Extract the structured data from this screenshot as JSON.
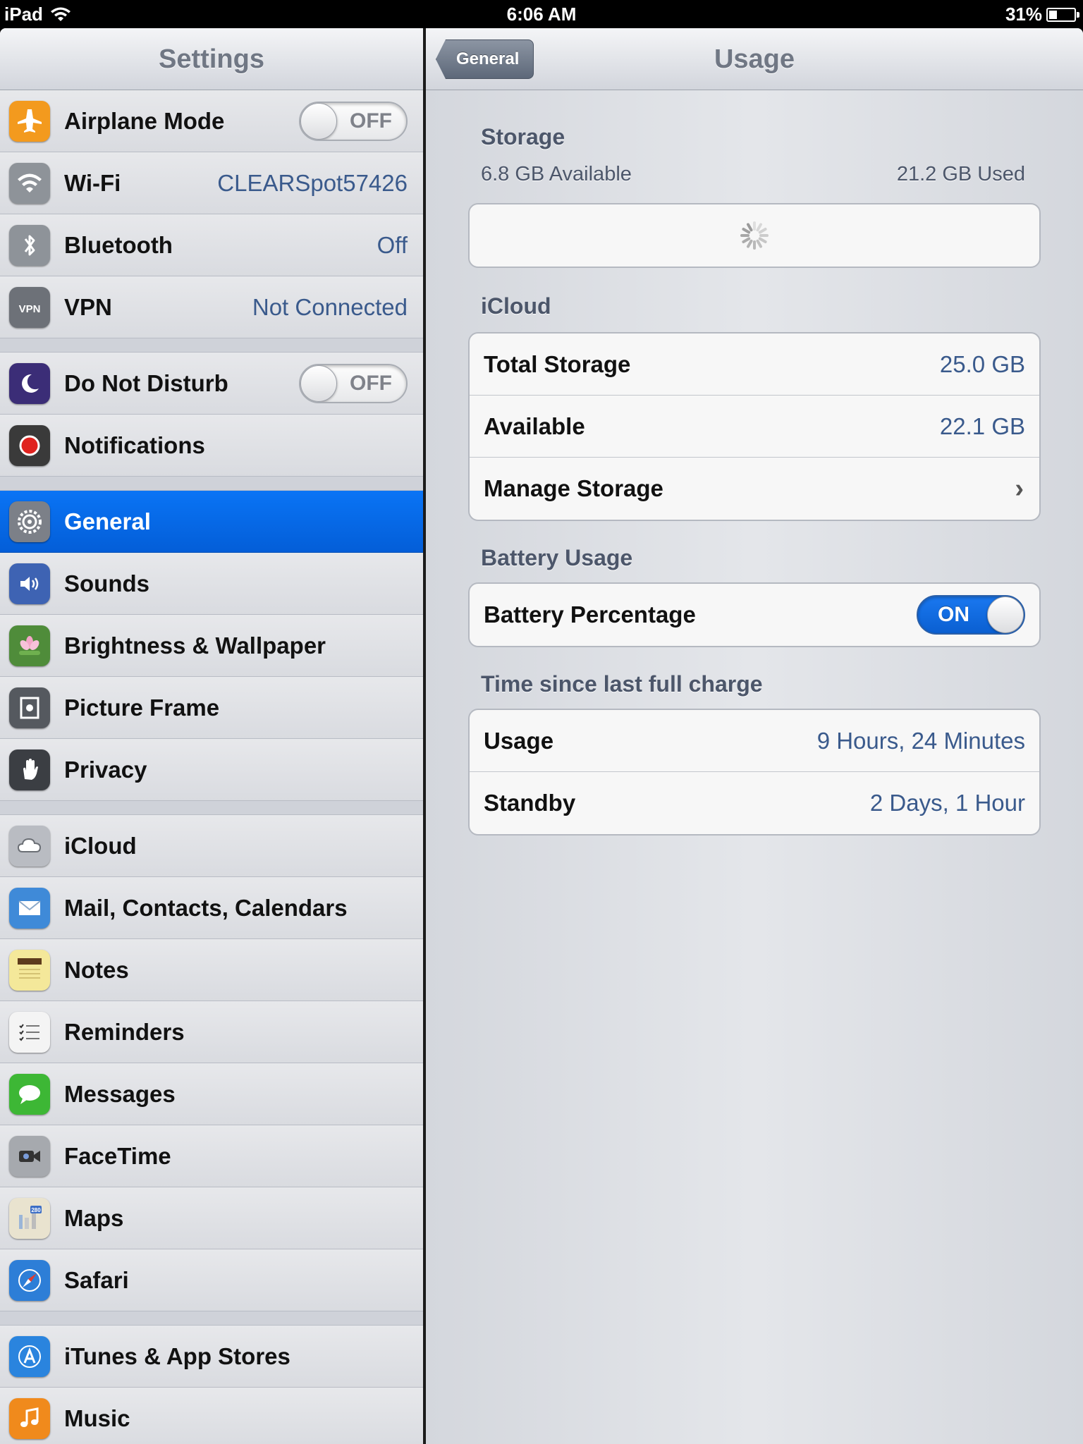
{
  "status_bar": {
    "device": "iPad",
    "time": "6:06 AM",
    "battery": "31%",
    "battery_level": 0.31
  },
  "master": {
    "title": "Settings",
    "groups": [
      [
        {
          "id": "airplane",
          "label": "Airplane Mode",
          "icon": "airplane-icon",
          "color": "#f39a1e",
          "switch": "OFF"
        },
        {
          "id": "wifi",
          "label": "Wi-Fi",
          "icon": "wifi-icon",
          "color": "#8e9399",
          "value": "CLEARSpot57426"
        },
        {
          "id": "bluetooth",
          "label": "Bluetooth",
          "icon": "bluetooth-icon",
          "color": "#8e9399",
          "value": "Off"
        },
        {
          "id": "vpn",
          "label": "VPN",
          "icon": "vpn-icon",
          "color": "#6d7178",
          "value": "Not Connected"
        }
      ],
      [
        {
          "id": "dnd",
          "label": "Do Not Disturb",
          "icon": "moon-icon",
          "color": "#3b2d77",
          "switch": "OFF"
        },
        {
          "id": "notifications",
          "label": "Notifications",
          "icon": "notifications-icon",
          "color": "#3a3a3a"
        }
      ],
      [
        {
          "id": "general",
          "label": "General",
          "icon": "gear-icon",
          "color": "#7c8088",
          "selected": true
        },
        {
          "id": "sounds",
          "label": "Sounds",
          "icon": "speaker-icon",
          "color": "#3e63b3"
        },
        {
          "id": "brightness",
          "label": "Brightness & Wallpaper",
          "icon": "flower-icon",
          "color": "#4f8c3a"
        },
        {
          "id": "pictureframe",
          "label": "Picture Frame",
          "icon": "picture-frame-icon",
          "color": "#55595f"
        },
        {
          "id": "privacy",
          "label": "Privacy",
          "icon": "hand-icon",
          "color": "#3b3e43"
        }
      ],
      [
        {
          "id": "icloud",
          "label": "iCloud",
          "icon": "cloud-icon",
          "color": "#b9bcc2"
        },
        {
          "id": "mail",
          "label": "Mail, Contacts, Calendars",
          "icon": "mail-icon",
          "color": "#3f8ad8"
        },
        {
          "id": "notes",
          "label": "Notes",
          "icon": "notes-icon",
          "color": "#f4e89a"
        },
        {
          "id": "reminders",
          "label": "Reminders",
          "icon": "reminders-icon",
          "color": "#f4f4f4"
        },
        {
          "id": "messages",
          "label": "Messages",
          "icon": "messages-icon",
          "color": "#3db735"
        },
        {
          "id": "facetime",
          "label": "FaceTime",
          "icon": "facetime-icon",
          "color": "#a6a9ae"
        },
        {
          "id": "maps",
          "label": "Maps",
          "icon": "maps-icon",
          "color": "#e9e3cf"
        },
        {
          "id": "safari",
          "label": "Safari",
          "icon": "compass-icon",
          "color": "#2d7ed7"
        }
      ],
      [
        {
          "id": "itunes",
          "label": "iTunes & App Stores",
          "icon": "app-store-icon",
          "color": "#2a84de"
        },
        {
          "id": "music",
          "label": "Music",
          "icon": "music-note-icon",
          "color": "#f08a1c"
        }
      ]
    ]
  },
  "detail": {
    "back_label": "General",
    "title": "Usage",
    "storage": {
      "header": "Storage",
      "available": "6.8 GB Available",
      "used": "21.2 GB Used"
    },
    "icloud": {
      "header": "iCloud",
      "rows": [
        {
          "label": "Total Storage",
          "value": "25.0 GB"
        },
        {
          "label": "Available",
          "value": "22.1 GB"
        },
        {
          "label": "Manage Storage"
        }
      ]
    },
    "battery": {
      "header": "Battery Usage",
      "label": "Battery Percentage",
      "switch": "ON"
    },
    "time_since": {
      "header": "Time since last full charge",
      "rows": [
        {
          "label": "Usage",
          "value": "9 Hours, 24 Minutes"
        },
        {
          "label": "Standby",
          "value": "2 Days, 1 Hour"
        }
      ]
    }
  }
}
